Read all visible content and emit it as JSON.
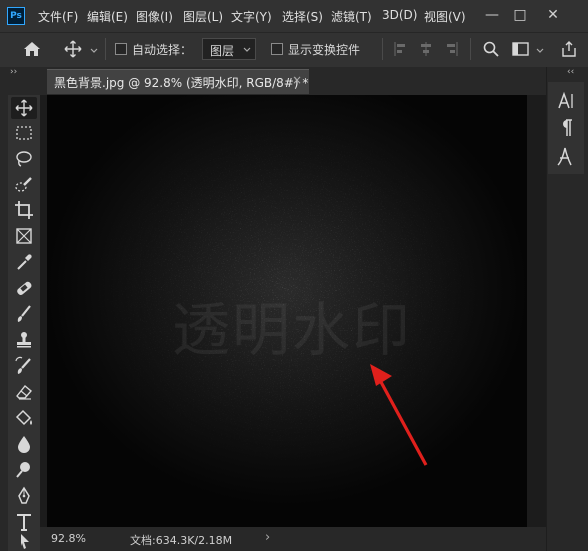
{
  "app": {
    "logo_text": "Ps"
  },
  "menu": {
    "items": [
      "文件(F)",
      "编辑(E)",
      "图像(I)",
      "图层(L)",
      "文字(Y)",
      "选择(S)",
      "滤镜(T)",
      "3D(D)",
      "视图(V)"
    ]
  },
  "window_controls": {
    "minimize": "—",
    "maximize": "□",
    "close": "✕"
  },
  "options_bar": {
    "auto_select_label": "自动选择：",
    "auto_select_target": "图层",
    "show_transform_label": "显示变换控件"
  },
  "document_tab": {
    "title": "黑色背景.jpg @ 92.8% (透明水印, RGB/8#) *",
    "close": "×"
  },
  "canvas": {
    "watermark_text": "透明水印",
    "background_color": "#050505",
    "arrow_color": "#e0201c"
  },
  "status_bar": {
    "zoom": "92.8%",
    "doc_info": "文档:634.3K/2.18M",
    "arrow": "›"
  },
  "icons": {
    "collapse_left": "››",
    "collapse_right": "‹‹"
  }
}
